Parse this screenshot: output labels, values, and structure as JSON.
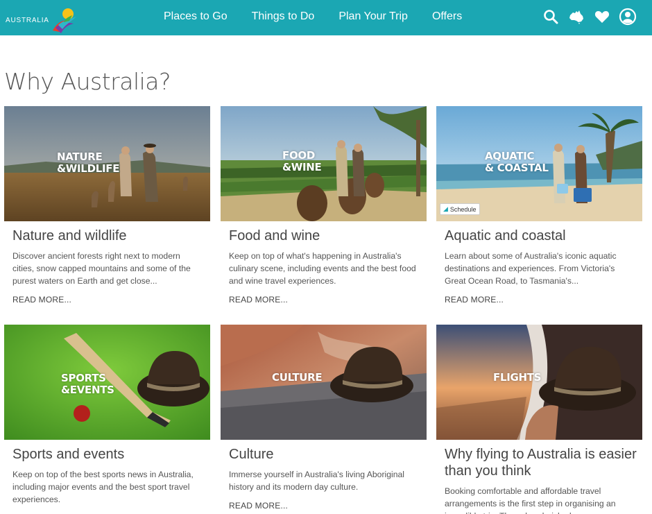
{
  "brand": {
    "name": "AUSTRALIA"
  },
  "nav": {
    "items": [
      {
        "label": "Places to Go"
      },
      {
        "label": "Things to Do"
      },
      {
        "label": "Plan Your Trip"
      },
      {
        "label": "Offers"
      }
    ]
  },
  "header_icons": [
    "search-icon",
    "australia-map-icon",
    "heart-icon",
    "user-icon"
  ],
  "colors": {
    "header": "#1ba7b3",
    "text": "#444444",
    "background": "#ffffff"
  },
  "page": {
    "title": "Why Australia?"
  },
  "cards": [
    {
      "image_label": "NATURE\n&WILDLIFE",
      "title": "Nature and wildlife",
      "description": "Discover ancient forests right next to modern cities, snow capped mountains and some of the purest waters on Earth and get close...",
      "link": "READ MORE..."
    },
    {
      "image_label": "FOOD\n&WINE",
      "title": "Food and wine",
      "description": "Keep on top of what's happening in Australia's culinary scene, including events and the best food and wine travel experiences.",
      "link": "READ MORE..."
    },
    {
      "image_label": "AQUATIC\n& COASTAL",
      "title": "Aquatic and coastal",
      "description": "Learn about some of Australia's iconic aquatic destinations and experiences. From Victoria's Great Ocean Road, to Tasmania's...",
      "link": "READ MORE...",
      "badge": "Schedule"
    },
    {
      "image_label": "SPORTS\n&EVENTS",
      "title": "Sports and events",
      "description": "Keep on top of the best sports news in Australia, including major events and the best sport travel experiences.",
      "link": ""
    },
    {
      "image_label": "CULTURE",
      "title": "Culture",
      "description": "Immerse yourself in Australia's living Aboriginal history and its modern day culture.",
      "link": "READ MORE..."
    },
    {
      "image_label": "FLIGHTS",
      "title": "Why flying to Australia is easier than you think",
      "description": "Booking comfortable and affordable travel arrangements is the first step in organising an incredible trip. These hand-picked...",
      "link": ""
    }
  ]
}
